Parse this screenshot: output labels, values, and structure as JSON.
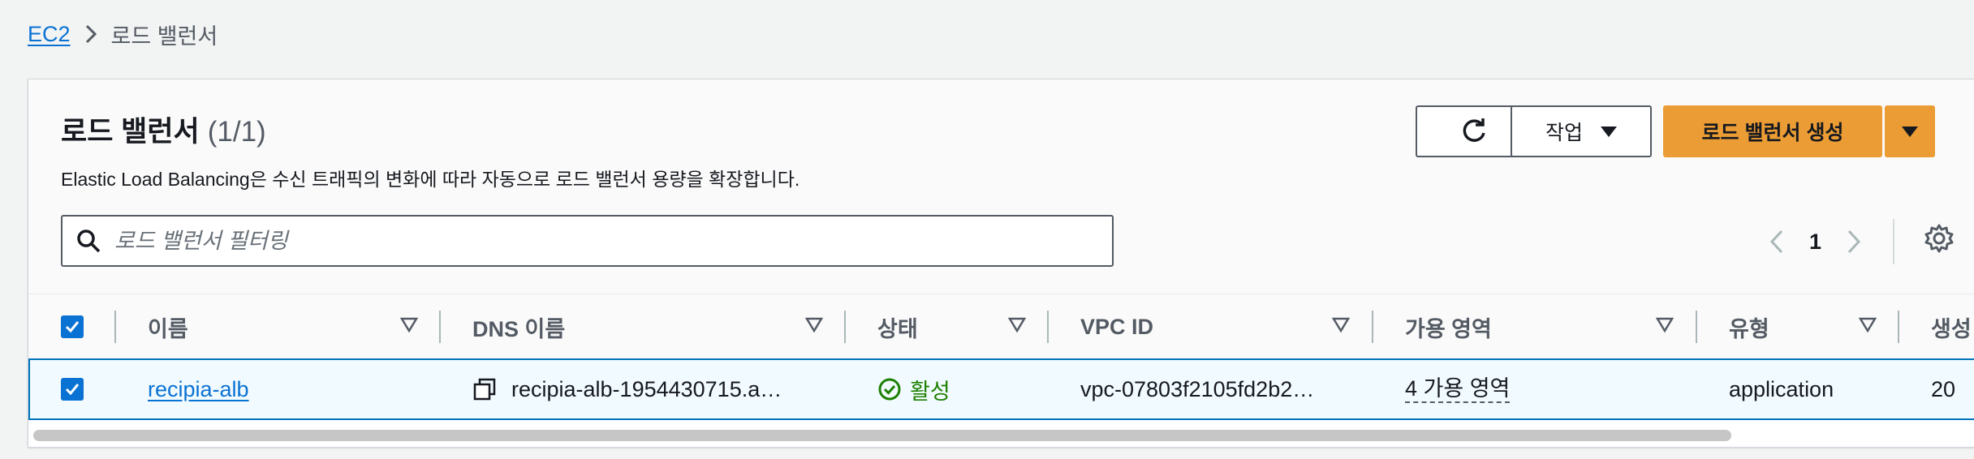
{
  "breadcrumb": {
    "root": "EC2",
    "current": "로드 밸런서"
  },
  "header": {
    "title": "로드 밸런서",
    "count": "(1/1)",
    "description": "Elastic Load Balancing은 수신 트래픽의 변화에 따라 자동으로 로드 밸런서 용량을 확장합니다."
  },
  "toolbar": {
    "actions_label": "작업",
    "create_label": "로드 밸런서 생성"
  },
  "search": {
    "placeholder": "로드 밸런서 필터링"
  },
  "pagination": {
    "current_page": "1"
  },
  "table": {
    "columns": [
      "이름",
      "DNS 이름",
      "상태",
      "VPC ID",
      "가용 영역",
      "유형",
      "생성"
    ],
    "rows": [
      {
        "name": "recipia-alb",
        "dns_name": "recipia-alb-1954430715.a…",
        "status": "활성",
        "vpc_id": "vpc-07803f2105fd2b2…",
        "availability_zones": "4 가용 영역",
        "type": "application",
        "created": "20"
      }
    ]
  },
  "colors": {
    "link": "#0972d3",
    "primary_button": "#ec9c34",
    "status_active": "#1d8102",
    "selected_row_bg": "#f1faff",
    "selected_row_border": "#0073bb"
  }
}
